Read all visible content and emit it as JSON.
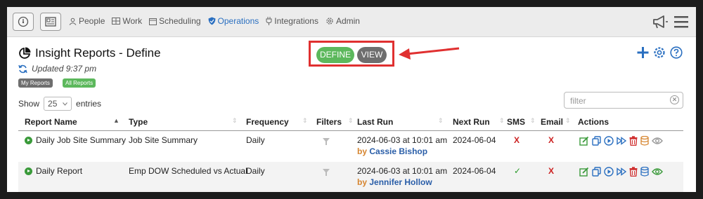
{
  "nav": {
    "items": [
      {
        "label": "People",
        "icon": "person-icon"
      },
      {
        "label": "Work",
        "icon": "grid-icon"
      },
      {
        "label": "Scheduling",
        "icon": "calendar-icon"
      },
      {
        "label": "Operations",
        "icon": "shield-icon",
        "active": true
      },
      {
        "label": "Integrations",
        "icon": "plug-icon"
      },
      {
        "label": "Admin",
        "icon": "gear-icon"
      }
    ]
  },
  "header": {
    "title": "Insight Reports - Define",
    "updated": "Updated 9:37 pm",
    "tags": [
      "My Reports",
      "All Reports"
    ],
    "define_label": "DEFINE",
    "view_label": "VIEW"
  },
  "controls": {
    "show_label": "Show",
    "entries_value": "25",
    "entries_label": "entries",
    "filter_placeholder": "filter"
  },
  "table": {
    "columns": [
      "Report Name",
      "Type",
      "Frequency",
      "Filters",
      "Last Run",
      "Next Run",
      "SMS",
      "Email",
      "Actions"
    ],
    "rows": [
      {
        "name": "Daily Job Site Summary",
        "type": "Job Site Summary",
        "frequency": "Daily",
        "last_run": "2024-06-03 at 10:01 am",
        "by_prefix": "by",
        "by_user": "Cassie Bishop",
        "next_run": "2024-06-04",
        "sms": "X",
        "email": "X"
      },
      {
        "name": "Daily Report",
        "type": "Emp DOW Scheduled vs Actual",
        "frequency": "Daily",
        "last_run": "2024-06-03 at 10:01 am",
        "by_prefix": "by",
        "by_user": "Jennifer Hollow",
        "next_run": "2024-06-04",
        "sms": "✓",
        "email": "X"
      }
    ]
  },
  "colors": {
    "accent": "#2a6fc0",
    "define": "#5cb85c",
    "view": "#6e6e6e",
    "highlight": "#e03030",
    "tag_my": "#6e6e6e",
    "tag_all": "#5cb85c"
  }
}
